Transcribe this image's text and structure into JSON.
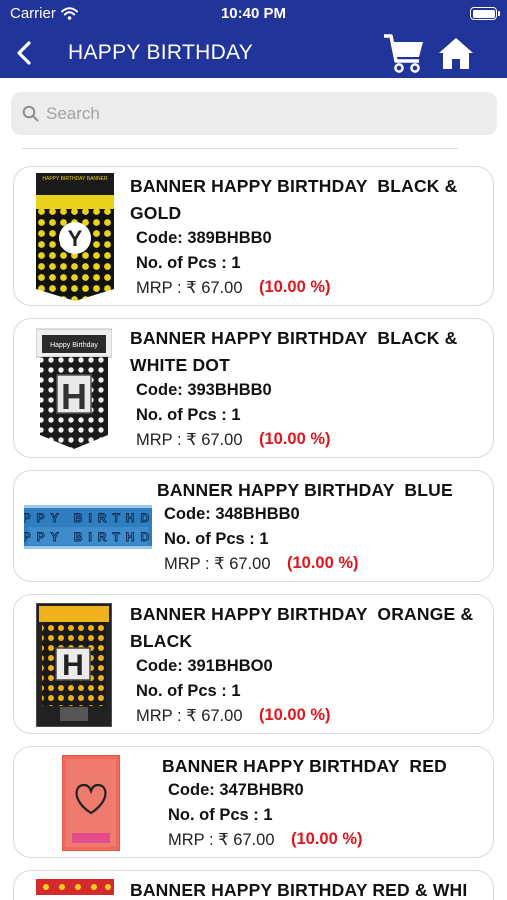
{
  "status_bar": {
    "carrier": "Carrier",
    "time": "10:40 PM"
  },
  "header": {
    "title": "HAPPY BIRTHDAY",
    "back_icon": "chevron-left-icon",
    "cart_icon": "cart-icon",
    "home_icon": "home-icon",
    "color": "#21349a"
  },
  "search": {
    "placeholder": "Search",
    "value": ""
  },
  "products": [
    {
      "name": "BANNER HAPPY BIRTHDAY  BLACK &\nGOLD",
      "code": "Code: 389BHBB0",
      "pcs": "No. of Pcs : 1",
      "mrp": "MRP : ₹ 67.00",
      "discount": "(10.00 %)"
    },
    {
      "name": "BANNER HAPPY BIRTHDAY  BLACK &\nWHITE DOT",
      "code": "Code: 393BHBB0",
      "pcs": "No. of Pcs : 1",
      "mrp": "MRP : ₹ 67.00",
      "discount": "(10.00 %)"
    },
    {
      "name": "BANNER HAPPY BIRTHDAY  BLUE",
      "code": "Code: 348BHBB0",
      "pcs": "No. of Pcs : 1",
      "mrp": "MRP : ₹ 67.00",
      "discount": "(10.00 %)"
    },
    {
      "name": "BANNER HAPPY BIRTHDAY  ORANGE &\nBLACK",
      "code": "Code: 391BHBO0",
      "pcs": "No. of Pcs : 1",
      "mrp": "MRP : ₹ 67.00",
      "discount": "(10.00 %)"
    },
    {
      "name": "BANNER HAPPY BIRTHDAY  RED",
      "code": "Code: 347BHBR0",
      "pcs": "No. of Pcs : 1",
      "mrp": "MRP : ₹ 67.00",
      "discount": "(10.00 %)"
    },
    {
      "name": "BANNER HAPPY BIRTHDAY  RED & WHI"
    }
  ],
  "thumb_text": {
    "gold_banner": "HAPPY BIRTHDAY BANNER",
    "gold_letter": "Y",
    "dot_banner": "Happy Birthday",
    "dot_letter": "H",
    "blue_banner": "HAPPY BIRTHDAY",
    "orange_letter": "H"
  },
  "colors": {
    "accent": "#21349a",
    "discount": "#e0141b",
    "card_border": "#d9d9d9"
  }
}
